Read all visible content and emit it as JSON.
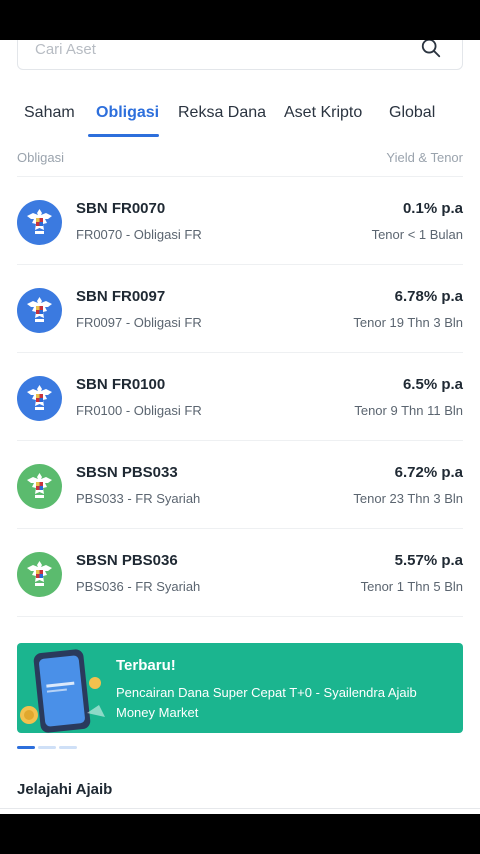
{
  "search": {
    "placeholder": "Cari Aset"
  },
  "tabs": [
    {
      "label": "Saham"
    },
    {
      "label": "Obligasi",
      "active": true
    },
    {
      "label": "Reksa Dana"
    },
    {
      "label": "Aset Kripto"
    },
    {
      "label": "Global"
    }
  ],
  "list_header": {
    "left": "Obligasi",
    "right": "Yield & Tenor"
  },
  "bonds": [
    {
      "name": "SBN FR0070",
      "subtitle": "FR0070 - Obligasi FR",
      "yield": "0.1% p.a",
      "tenor": "Tenor < 1 Bulan",
      "logo_color": "blue"
    },
    {
      "name": "SBN FR0097",
      "subtitle": "FR0097 - Obligasi FR",
      "yield": "6.78% p.a",
      "tenor": "Tenor 19 Thn 3 Bln",
      "logo_color": "blue"
    },
    {
      "name": "SBN FR0100",
      "subtitle": "FR0100 - Obligasi FR",
      "yield": "6.5% p.a",
      "tenor": "Tenor 9 Thn 11 Bln",
      "logo_color": "blue"
    },
    {
      "name": "SBSN PBS033",
      "subtitle": "PBS033 - FR Syariah",
      "yield": "6.72% p.a",
      "tenor": "Tenor 23 Thn 3 Bln",
      "logo_color": "green"
    },
    {
      "name": "SBSN PBS036",
      "subtitle": "PBS036 - FR Syariah",
      "yield": "5.57% p.a",
      "tenor": "Tenor 1 Thn 5 Bln",
      "logo_color": "green"
    }
  ],
  "banner": {
    "title": "Terbaru!",
    "description": "Pencairan Dana Super Cepat T+0 - Syailendra Ajaib Money Market",
    "background": "#1bb58f"
  },
  "carousel": {
    "count": 3,
    "active_index": 0
  },
  "section": {
    "title": "Jelajahi Ajaib"
  },
  "colors": {
    "accent": "#2d6fdc",
    "bond_blue": "#3b7ae0",
    "bond_green": "#5bbb6e"
  }
}
